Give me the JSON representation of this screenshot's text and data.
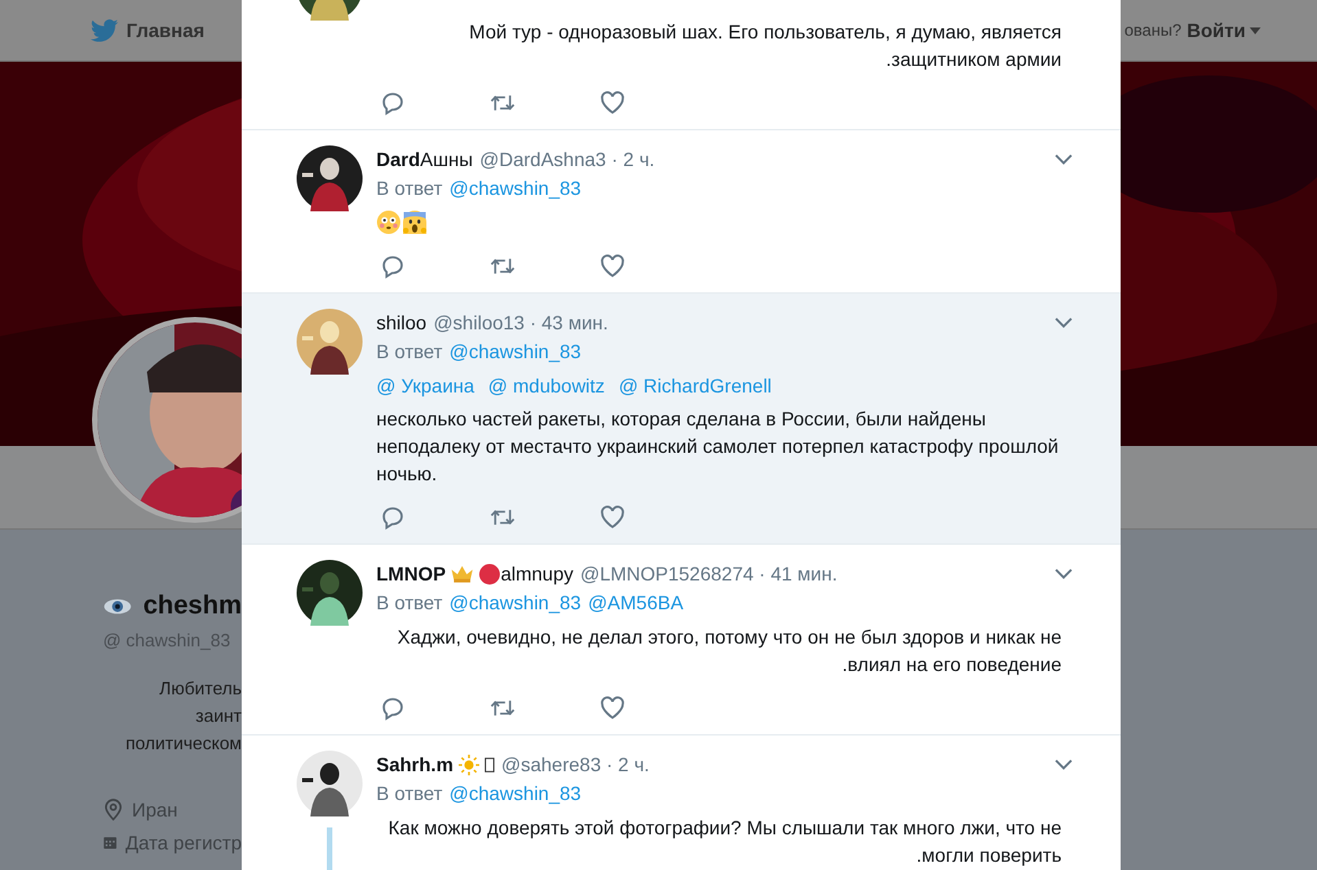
{
  "nav": {
    "items": [
      "Главная"
    ],
    "login_prompt": "ованы?",
    "login": "Войти"
  },
  "profile": {
    "name": "cheshm",
    "handle": "@ chawshin_83",
    "bio": [
      "Любитель",
      "заинт",
      "политическом"
    ],
    "location": "Иран",
    "joined": "Дата регистр"
  },
  "tweets": [
    {
      "body": "Мой тур - одноразовый шах. Его пользователь, я думаю, является\n.защитником армии",
      "right_aligned": true,
      "highlighted": false,
      "thread": false
    },
    {
      "name": "Dard",
      "name_bold": true,
      "name_rest": "Ашны",
      "meta": "@DardAshna3 · 2 ч.",
      "reply_label": "В ответ",
      "reply_to": [
        "@chawshin_83"
      ],
      "emojis": [
        {
          "kind": "flushed"
        },
        {
          "kind": "scream"
        }
      ],
      "highlighted": false,
      "thread": false
    },
    {
      "name": "shiloo",
      "name_bold": false,
      "meta": "@shiloo13 · 43 мин.",
      "reply_label": "В ответ",
      "reply_to": [
        "@chawshin_83"
      ],
      "mentions": [
        "@ Украина",
        "@ mdubowitz",
        "@ RichardGrenell"
      ],
      "body": "несколько частей ракеты, которая сделана в России, были найдены\nнеподалеку от местачто украинский самолет потерпел катастрофу прошлой\nночью.",
      "right_aligned": false,
      "highlighted": true,
      "thread": false
    },
    {
      "name": "LMNOP",
      "name_bold": true,
      "badges": [
        {
          "kind": "crown"
        },
        {
          "kind": "red_circle"
        }
      ],
      "name_rest": "almnupy",
      "meta": "@LMNOP15268274 · 41 мин.",
      "reply_label": "В ответ",
      "reply_to": [
        "@chawshin_83",
        "@AM56BA"
      ],
      "body": "Хаджи, очевидно, не делал этого, потому что он не был здоров и никак не\n.влиял на его поведение",
      "right_aligned": true,
      "highlighted": false,
      "thread": false
    },
    {
      "name": "Sahrh.m",
      "name_bold": true,
      "badges": [
        {
          "kind": "sun"
        },
        {
          "kind": "missing_glyph"
        }
      ],
      "meta": "@sahere83 · 2 ч.",
      "reply_label": "В ответ",
      "reply_to": [
        "@chawshin_83"
      ],
      "body": "Как можно доверять этой фотографии? Мы слышали так много лжи, что не\n.могли поверить",
      "right_aligned": true,
      "highlighted": false,
      "thread": true
    }
  ]
}
